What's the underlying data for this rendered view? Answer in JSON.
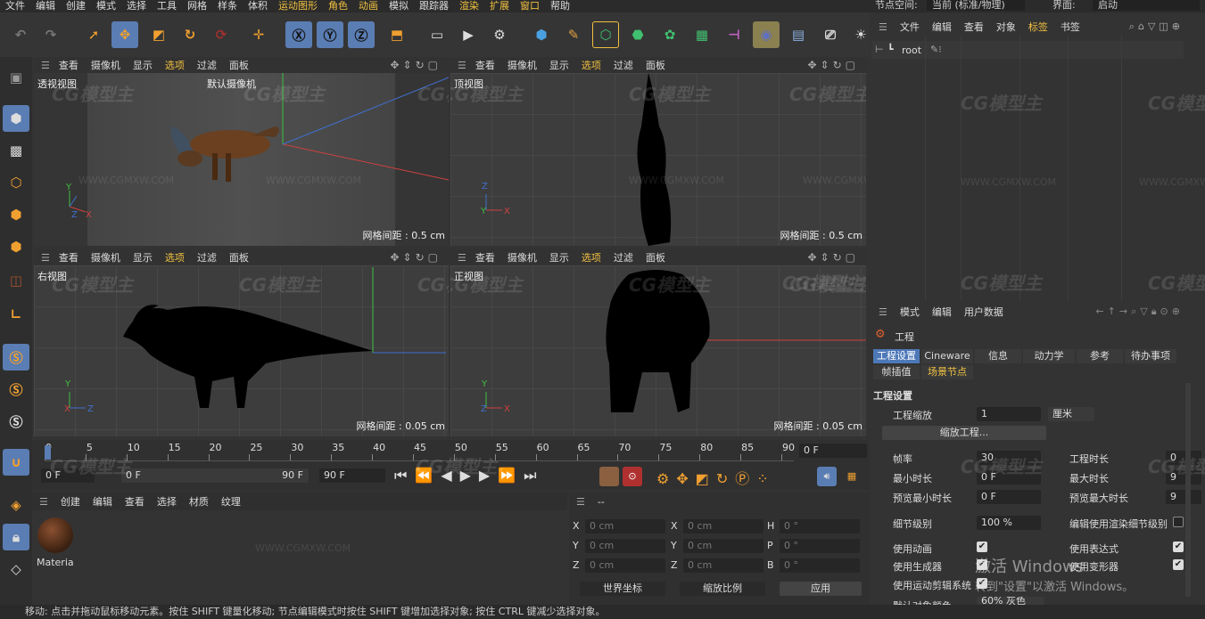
{
  "menubar": [
    "文件",
    "编辑",
    "创建",
    "模式",
    "选择",
    "工具",
    "网格",
    "样条",
    "体积",
    "运动图形",
    "角色",
    "动画",
    "模拟",
    "跟踪器",
    "渲染",
    "扩展",
    "窗口",
    "帮助"
  ],
  "right_top": {
    "node_space_label": "节点空间:",
    "node_space_value": "当前 (标准/物理)",
    "layout_label": "界面:",
    "layout_value": "启动"
  },
  "viewport_menu": [
    "查看",
    "摄像机",
    "显示",
    "选项",
    "过滤",
    "面板"
  ],
  "viewports": [
    {
      "name": "透视视图",
      "camera": "默认摄像机",
      "grid": "网格间距 : 0.5 cm"
    },
    {
      "name": "顶视图",
      "grid": "网格间距 : 0.5 cm"
    },
    {
      "name": "右视图",
      "grid": "网格间距 : 0.05 cm"
    },
    {
      "name": "正视图",
      "grid": "网格间距 : 0.05 cm"
    }
  ],
  "watermark": "CG模型主",
  "watermark_url": "WWW.CGMXW.COM",
  "timeline": {
    "ticks": [
      "0",
      "5",
      "10",
      "15",
      "20",
      "25",
      "30",
      "35",
      "40",
      "45",
      "50",
      "55",
      "60",
      "65",
      "70",
      "75",
      "80",
      "85",
      "90"
    ],
    "current_frame": "0 F",
    "start": "0 F",
    "range_start": "0 F",
    "range_end": "90 F",
    "end": "90 F"
  },
  "material_panel": {
    "menu": [
      "创建",
      "编辑",
      "查看",
      "选择",
      "材质",
      "纹理"
    ],
    "material_name": "Materia"
  },
  "coord_panel": {
    "header": "--",
    "rows": [
      {
        "a": "X",
        "av": "0 cm",
        "b": "X",
        "bv": "0 cm",
        "c": "H",
        "cv": "0 °"
      },
      {
        "a": "Y",
        "av": "0 cm",
        "b": "Y",
        "bv": "0 cm",
        "c": "P",
        "cv": "0 °"
      },
      {
        "a": "Z",
        "av": "0 cm",
        "b": "Z",
        "bv": "0 cm",
        "c": "B",
        "cv": "0 °"
      }
    ],
    "world": "世界坐标",
    "scale": "缩放比例",
    "apply": "应用"
  },
  "object_manager": {
    "menu": [
      "文件",
      "编辑",
      "查看",
      "对象",
      "标签",
      "书签"
    ],
    "root": "root"
  },
  "attr_manager": {
    "menu": [
      "模式",
      "编辑",
      "用户数据"
    ],
    "title": "工程",
    "tabs_row1": [
      "工程设置",
      "Cineware",
      "信息",
      "动力学",
      "参考",
      "待办事项"
    ],
    "tabs_row2": [
      "帧插值",
      "场景节点"
    ],
    "section": "工程设置",
    "project_scale_label": "工程缩放",
    "project_scale_value": "1",
    "project_scale_unit": "厘米",
    "scale_project_btn": "缩放工程...",
    "fps_label": "帧率",
    "fps_value": "30",
    "project_time_label": "工程时长",
    "project_time_value": "0",
    "min_time_label": "最小时长",
    "min_time_value": "0 F",
    "max_time_label": "最大时长",
    "max_time_value": "9",
    "preview_min_label": "预览最小时长",
    "preview_min_value": "0 F",
    "preview_max_label": "预览最大时长",
    "preview_max_value": "9",
    "lod_label": "细节级别",
    "lod_value": "100 %",
    "render_lod_label": "编辑使用渲染细节级别",
    "use_anim_label": "使用动画",
    "use_expr_label": "使用表达式",
    "use_gen_label": "使用生成器",
    "use_deform_label": "使用变形器",
    "use_motion_label": "使用运动剪辑系统",
    "default_color_label": "默认对象颜色",
    "default_color_value": "60% 灰色",
    "activate1": "激活 Windows",
    "activate2": "转到\"设置\"以激活 Windows。"
  },
  "status_text": "移动: 点击并拖动鼠标移动元素。按住 SHIFT 键量化移动; 节点编辑模式时按住 SHIFT 键增加选择对象; 按住 CTRL 键减少选择对象。",
  "colors": {
    "accent": "#5a7db3",
    "highlight": "#f0c040",
    "axis_x": "#d04040",
    "axis_y": "#40c040",
    "axis_z": "#4070d0"
  }
}
